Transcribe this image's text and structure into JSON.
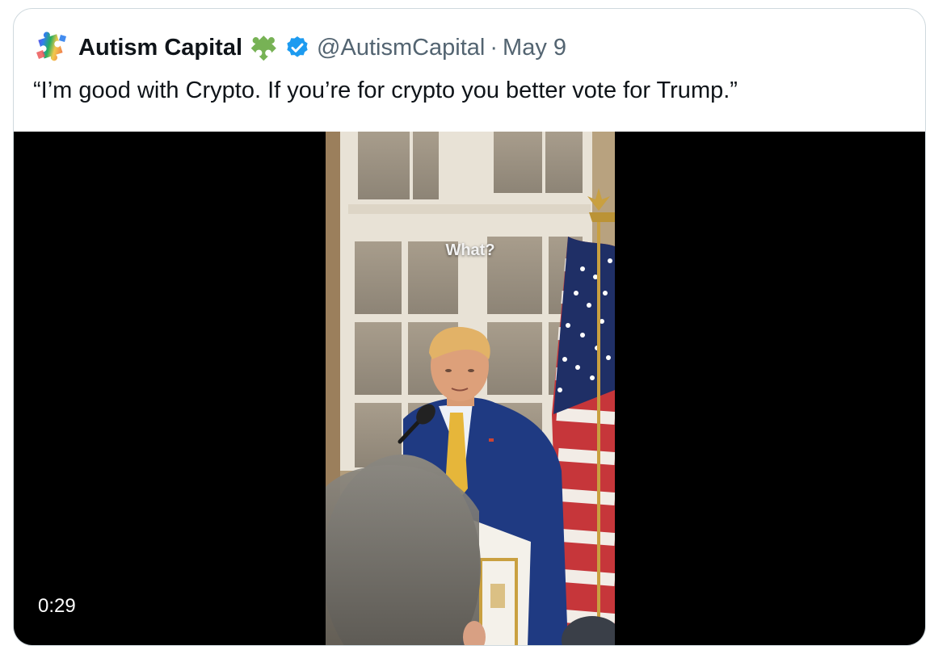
{
  "tweet": {
    "author_name": "Autism Capital",
    "handle": "@AutismCapital",
    "separator": "·",
    "date": "May 9",
    "text": "“I’m good with Crypto. If you’re for crypto you better vote for Trump.”"
  },
  "video": {
    "caption": "What?",
    "duration": "0:29"
  },
  "icons": {
    "avatar": "rainbow-puzzle-icon",
    "name_emoji": "puzzle-piece-icon",
    "verified": "verified-badge-icon"
  },
  "colors": {
    "text_primary": "#0f1419",
    "text_secondary": "#536471",
    "border": "#cfd9de",
    "verified_blue": "#1d9bf0",
    "puzzle_green": "#77b255"
  }
}
